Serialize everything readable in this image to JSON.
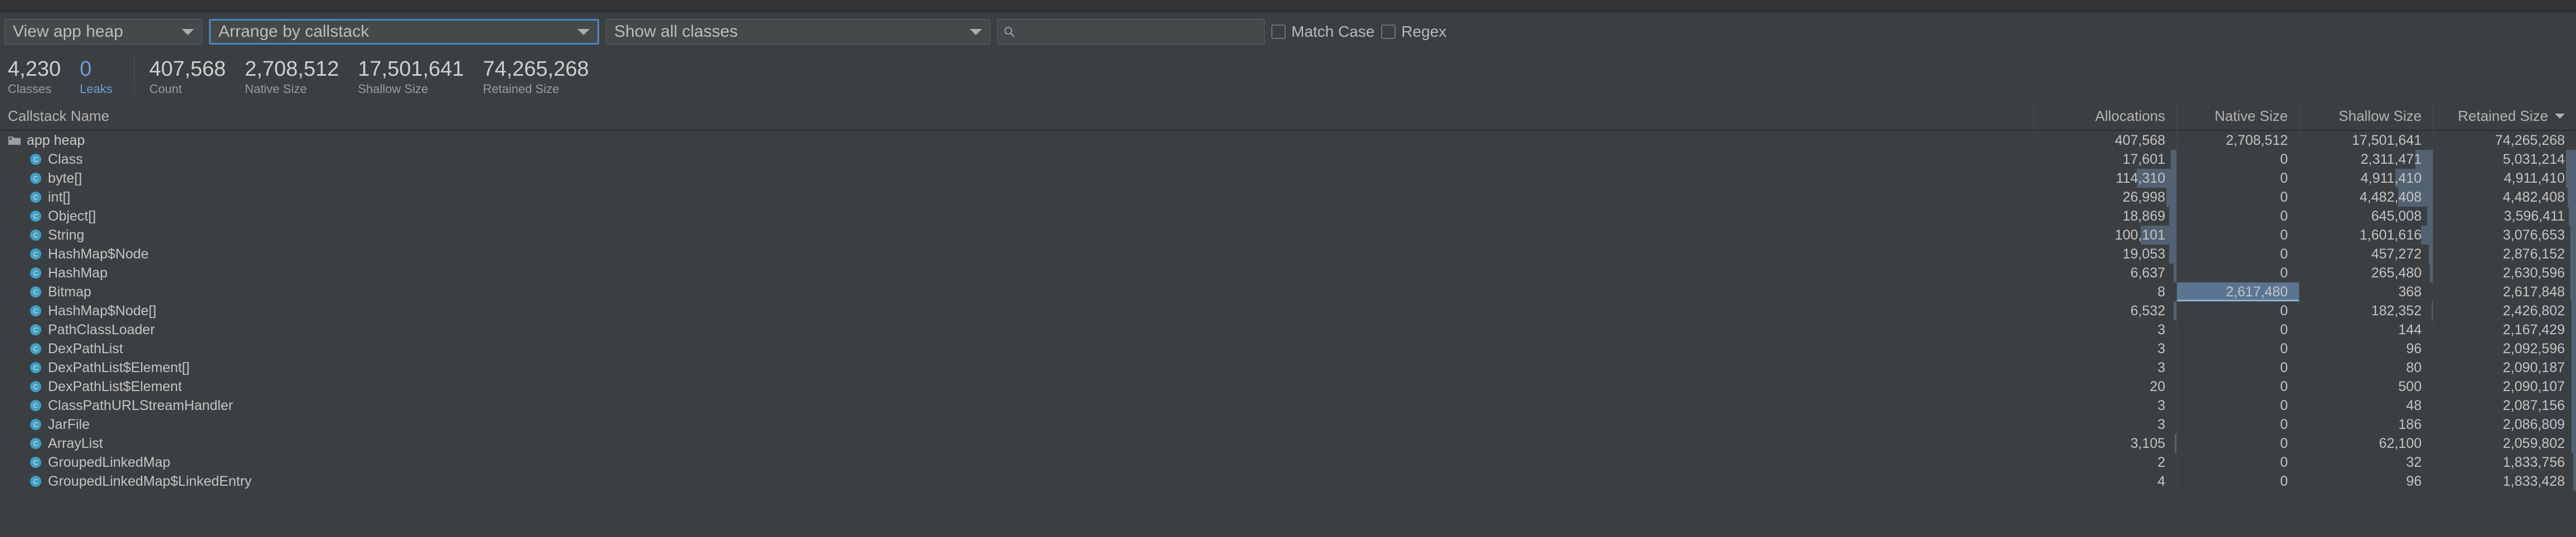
{
  "window": {
    "accent_color": "#4a88c7",
    "background": "#3c3f41",
    "bar_color": "#6c8fb2"
  },
  "toolbar": {
    "heap_select": {
      "label": "View app heap",
      "icon": "chevron-down-icon"
    },
    "arrange_select": {
      "label": "Arrange by callstack",
      "icon": "chevron-down-icon"
    },
    "classes_select": {
      "label": "Show all classes",
      "icon": "chevron-down-icon"
    },
    "search": {
      "value": "",
      "placeholder": "",
      "icon": "search-icon"
    },
    "match_case": {
      "label": "Match Case",
      "checked": false
    },
    "regex": {
      "label": "Regex",
      "checked": false
    }
  },
  "stats": [
    {
      "value": "4,230",
      "label": "Classes",
      "highlight": false
    },
    {
      "value": "0",
      "label": "Leaks",
      "highlight": true
    },
    {
      "value": "407,568",
      "label": "Count",
      "highlight": false
    },
    {
      "value": "2,708,512",
      "label": "Native Size",
      "highlight": false
    },
    {
      "value": "17,501,641",
      "label": "Shallow Size",
      "highlight": false
    },
    {
      "value": "74,265,268",
      "label": "Retained Size",
      "highlight": false
    }
  ],
  "table": {
    "columns": {
      "name": "Callstack Name",
      "allocations": "Allocations",
      "native": "Native Size",
      "shallow": "Shallow Size",
      "retained": "Retained Size"
    },
    "sort": {
      "column": "Retained Size",
      "direction": "desc",
      "icon": "caret-down-icon"
    },
    "rows": [
      {
        "name": "app heap",
        "icon": "folder-icon",
        "depth": 0,
        "allocations": "407,568",
        "native": "2,708,512",
        "shallow": "17,501,641",
        "retained": "74,265,268",
        "alloc_pct": 0,
        "native_pct": 0,
        "shallow_pct": 0,
        "retained_pct": 0
      },
      {
        "name": "Class",
        "icon": "class-icon",
        "depth": 1,
        "allocations": "17,601",
        "native": "0",
        "shallow": "2,311,471",
        "retained": "5,031,214",
        "alloc_pct": 4,
        "native_pct": 0,
        "shallow_pct": 13,
        "retained_pct": 7
      },
      {
        "name": "byte[]",
        "icon": "class-icon",
        "depth": 1,
        "allocations": "114,310",
        "native": "0",
        "shallow": "4,911,410",
        "retained": "4,911,410",
        "alloc_pct": 28,
        "native_pct": 0,
        "shallow_pct": 28,
        "retained_pct": 7
      },
      {
        "name": "int[]",
        "icon": "class-icon",
        "depth": 1,
        "allocations": "26,998",
        "native": "0",
        "shallow": "4,482,408",
        "retained": "4,482,408",
        "alloc_pct": 7,
        "native_pct": 0,
        "shallow_pct": 26,
        "retained_pct": 6
      },
      {
        "name": "Object[]",
        "icon": "class-icon",
        "depth": 1,
        "allocations": "18,869",
        "native": "0",
        "shallow": "645,008",
        "retained": "3,596,411",
        "alloc_pct": 5,
        "native_pct": 0,
        "shallow_pct": 4,
        "retained_pct": 5
      },
      {
        "name": "String",
        "icon": "class-icon",
        "depth": 1,
        "allocations": "100,101",
        "native": "0",
        "shallow": "1,601,616",
        "retained": "3,076,653",
        "alloc_pct": 25,
        "native_pct": 0,
        "shallow_pct": 9,
        "retained_pct": 4
      },
      {
        "name": "HashMap$Node",
        "icon": "class-icon",
        "depth": 1,
        "allocations": "19,053",
        "native": "0",
        "shallow": "457,272",
        "retained": "2,876,152",
        "alloc_pct": 5,
        "native_pct": 0,
        "shallow_pct": 3,
        "retained_pct": 4
      },
      {
        "name": "HashMap",
        "icon": "class-icon",
        "depth": 1,
        "allocations": "6,637",
        "native": "0",
        "shallow": "265,480",
        "retained": "2,630,596",
        "alloc_pct": 2,
        "native_pct": 0,
        "shallow_pct": 2,
        "retained_pct": 4
      },
      {
        "name": "Bitmap",
        "icon": "class-icon",
        "depth": 1,
        "allocations": "8",
        "native": "2,617,480",
        "shallow": "368",
        "retained": "2,617,848",
        "alloc_pct": 0,
        "native_pct": 100,
        "shallow_pct": 0,
        "retained_pct": 4
      },
      {
        "name": "HashMap$Node[]",
        "icon": "class-icon",
        "depth": 1,
        "allocations": "6,532",
        "native": "0",
        "shallow": "182,352",
        "retained": "2,426,802",
        "alloc_pct": 2,
        "native_pct": 0,
        "shallow_pct": 1,
        "retained_pct": 3
      },
      {
        "name": "PathClassLoader",
        "icon": "class-icon",
        "depth": 1,
        "allocations": "3",
        "native": "0",
        "shallow": "144",
        "retained": "2,167,429",
        "alloc_pct": 0,
        "native_pct": 0,
        "shallow_pct": 0,
        "retained_pct": 3
      },
      {
        "name": "DexPathList",
        "icon": "class-icon",
        "depth": 1,
        "allocations": "3",
        "native": "0",
        "shallow": "96",
        "retained": "2,092,596",
        "alloc_pct": 0,
        "native_pct": 0,
        "shallow_pct": 0,
        "retained_pct": 3
      },
      {
        "name": "DexPathList$Element[]",
        "icon": "class-icon",
        "depth": 1,
        "allocations": "3",
        "native": "0",
        "shallow": "80",
        "retained": "2,090,187",
        "alloc_pct": 0,
        "native_pct": 0,
        "shallow_pct": 0,
        "retained_pct": 3
      },
      {
        "name": "DexPathList$Element",
        "icon": "class-icon",
        "depth": 1,
        "allocations": "20",
        "native": "0",
        "shallow": "500",
        "retained": "2,090,107",
        "alloc_pct": 0,
        "native_pct": 0,
        "shallow_pct": 0,
        "retained_pct": 3
      },
      {
        "name": "ClassPathURLStreamHandler",
        "icon": "class-icon",
        "depth": 1,
        "allocations": "3",
        "native": "0",
        "shallow": "48",
        "retained": "2,087,156",
        "alloc_pct": 0,
        "native_pct": 0,
        "shallow_pct": 0,
        "retained_pct": 3
      },
      {
        "name": "JarFile",
        "icon": "class-icon",
        "depth": 1,
        "allocations": "3",
        "native": "0",
        "shallow": "186",
        "retained": "2,086,809",
        "alloc_pct": 0,
        "native_pct": 0,
        "shallow_pct": 0,
        "retained_pct": 3
      },
      {
        "name": "ArrayList",
        "icon": "class-icon",
        "depth": 1,
        "allocations": "3,105",
        "native": "0",
        "shallow": "62,100",
        "retained": "2,059,802",
        "alloc_pct": 1,
        "native_pct": 0,
        "shallow_pct": 0,
        "retained_pct": 3
      },
      {
        "name": "GroupedLinkedMap",
        "icon": "class-icon",
        "depth": 1,
        "allocations": "2",
        "native": "0",
        "shallow": "32",
        "retained": "1,833,756",
        "alloc_pct": 0,
        "native_pct": 0,
        "shallow_pct": 0,
        "retained_pct": 2
      },
      {
        "name": "GroupedLinkedMap$LinkedEntry",
        "icon": "class-icon",
        "depth": 1,
        "allocations": "4",
        "native": "0",
        "shallow": "96",
        "retained": "1,833,428",
        "alloc_pct": 0,
        "native_pct": 0,
        "shallow_pct": 0,
        "retained_pct": 2
      }
    ]
  }
}
